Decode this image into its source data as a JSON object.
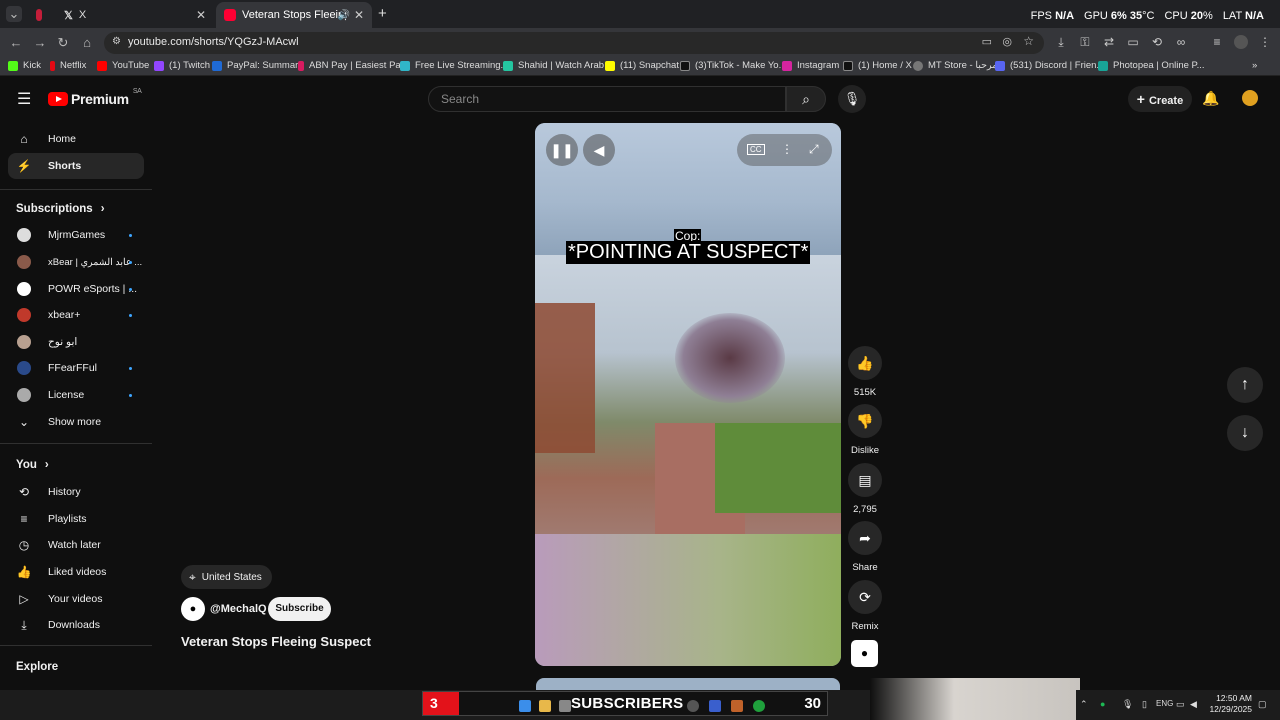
{
  "browser": {
    "tabs": [
      {
        "label": ""
      },
      {
        "label": "X"
      },
      {
        "label": "Veteran Stops Fleeing Susp"
      }
    ],
    "new_tab": "+",
    "url": "youtube.com/shorts/YQGzJ-MAcwl",
    "bookmarks": [
      "Kick",
      "Netflix",
      "YouTube",
      "(1) Twitch",
      "PayPal: Summary",
      "ABN Pay | Easiest Pa...",
      "Free Live Streaming...",
      "Shahid | Watch Arab...",
      "(11) Snapchat",
      "(3)TikTok - Make Yo...",
      "Instagram",
      "(1) Home / X",
      "MT Store - مرحبا",
      "(531) Discord | Frien...",
      "Photopea | Online P..."
    ]
  },
  "overlay": {
    "fps_label": "FPS",
    "fps": "N/A",
    "gpu_label": "GPU",
    "gpu": "6",
    "gpu_unit": "%",
    "gpu_temp": "35",
    "cpu_label": "CPU",
    "cpu": "20",
    "lat_label": "LAT",
    "lat": "N/A"
  },
  "header": {
    "logo": "Premium",
    "region": "SA",
    "search_placeholder": "Search",
    "create_label": "Create"
  },
  "sidebar": {
    "main": [
      {
        "label": "Home"
      },
      {
        "label": "Shorts"
      }
    ],
    "subscriptions_title": "Subscriptions",
    "subscriptions": [
      {
        "label": "MjrmGames"
      },
      {
        "label": "xBear | عابد الشمري ..."
      },
      {
        "label": "POWR eSports | ..."
      },
      {
        "label": "xbear+"
      },
      {
        "label": "ابو نوح"
      },
      {
        "label": "FFearFFul"
      },
      {
        "label": "License"
      }
    ],
    "show_more": "Show more",
    "you_title": "You",
    "you": [
      {
        "label": "History"
      },
      {
        "label": "Playlists"
      },
      {
        "label": "Watch later"
      },
      {
        "label": "Liked videos"
      },
      {
        "label": "Your videos"
      },
      {
        "label": "Downloads"
      }
    ],
    "explore_title": "Explore"
  },
  "video": {
    "caption_speaker": "Cop:",
    "caption_text": "*POINTING AT SUSPECT*"
  },
  "actions": {
    "likes": "515K",
    "dislike": "Dislike",
    "comments": "2,795",
    "share": "Share",
    "remix": "Remix"
  },
  "meta": {
    "location": "United States",
    "channel": "@MechalQ",
    "subscribe": "Subscribe",
    "title": "Veteran Stops Fleeing Suspect"
  },
  "taskbar": {
    "sub_count_left": "3",
    "sub_label": "SUBSCRIBERS",
    "sub_count_right": "30",
    "lang": "ENG",
    "time": "12:50 AM",
    "date": "12/29/2025"
  }
}
